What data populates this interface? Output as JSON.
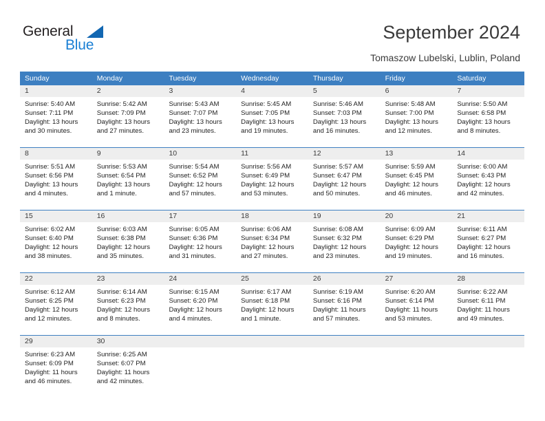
{
  "brand": {
    "name_part1": "General",
    "name_part2": "Blue",
    "logo_shape": "triangle-icon",
    "color_dark": "#231f20",
    "color_blue": "#1a7fd4"
  },
  "header": {
    "title": "September 2024",
    "subtitle": "Tomaszow Lubelski, Lublin, Poland"
  },
  "calendar": {
    "accent_color": "#3d7fc1",
    "daynum_background": "#eeeeee",
    "day_headers": [
      "Sunday",
      "Monday",
      "Tuesday",
      "Wednesday",
      "Thursday",
      "Friday",
      "Saturday"
    ],
    "weeks": [
      {
        "days": [
          {
            "num": "1",
            "sunrise": "Sunrise: 5:40 AM",
            "sunset": "Sunset: 7:11 PM",
            "daylight1": "Daylight: 13 hours",
            "daylight2": "and 30 minutes."
          },
          {
            "num": "2",
            "sunrise": "Sunrise: 5:42 AM",
            "sunset": "Sunset: 7:09 PM",
            "daylight1": "Daylight: 13 hours",
            "daylight2": "and 27 minutes."
          },
          {
            "num": "3",
            "sunrise": "Sunrise: 5:43 AM",
            "sunset": "Sunset: 7:07 PM",
            "daylight1": "Daylight: 13 hours",
            "daylight2": "and 23 minutes."
          },
          {
            "num": "4",
            "sunrise": "Sunrise: 5:45 AM",
            "sunset": "Sunset: 7:05 PM",
            "daylight1": "Daylight: 13 hours",
            "daylight2": "and 19 minutes."
          },
          {
            "num": "5",
            "sunrise": "Sunrise: 5:46 AM",
            "sunset": "Sunset: 7:03 PM",
            "daylight1": "Daylight: 13 hours",
            "daylight2": "and 16 minutes."
          },
          {
            "num": "6",
            "sunrise": "Sunrise: 5:48 AM",
            "sunset": "Sunset: 7:00 PM",
            "daylight1": "Daylight: 13 hours",
            "daylight2": "and 12 minutes."
          },
          {
            "num": "7",
            "sunrise": "Sunrise: 5:50 AM",
            "sunset": "Sunset: 6:58 PM",
            "daylight1": "Daylight: 13 hours",
            "daylight2": "and 8 minutes."
          }
        ]
      },
      {
        "days": [
          {
            "num": "8",
            "sunrise": "Sunrise: 5:51 AM",
            "sunset": "Sunset: 6:56 PM",
            "daylight1": "Daylight: 13 hours",
            "daylight2": "and 4 minutes."
          },
          {
            "num": "9",
            "sunrise": "Sunrise: 5:53 AM",
            "sunset": "Sunset: 6:54 PM",
            "daylight1": "Daylight: 13 hours",
            "daylight2": "and 1 minute."
          },
          {
            "num": "10",
            "sunrise": "Sunrise: 5:54 AM",
            "sunset": "Sunset: 6:52 PM",
            "daylight1": "Daylight: 12 hours",
            "daylight2": "and 57 minutes."
          },
          {
            "num": "11",
            "sunrise": "Sunrise: 5:56 AM",
            "sunset": "Sunset: 6:49 PM",
            "daylight1": "Daylight: 12 hours",
            "daylight2": "and 53 minutes."
          },
          {
            "num": "12",
            "sunrise": "Sunrise: 5:57 AM",
            "sunset": "Sunset: 6:47 PM",
            "daylight1": "Daylight: 12 hours",
            "daylight2": "and 50 minutes."
          },
          {
            "num": "13",
            "sunrise": "Sunrise: 5:59 AM",
            "sunset": "Sunset: 6:45 PM",
            "daylight1": "Daylight: 12 hours",
            "daylight2": "and 46 minutes."
          },
          {
            "num": "14",
            "sunrise": "Sunrise: 6:00 AM",
            "sunset": "Sunset: 6:43 PM",
            "daylight1": "Daylight: 12 hours",
            "daylight2": "and 42 minutes."
          }
        ]
      },
      {
        "days": [
          {
            "num": "15",
            "sunrise": "Sunrise: 6:02 AM",
            "sunset": "Sunset: 6:40 PM",
            "daylight1": "Daylight: 12 hours",
            "daylight2": "and 38 minutes."
          },
          {
            "num": "16",
            "sunrise": "Sunrise: 6:03 AM",
            "sunset": "Sunset: 6:38 PM",
            "daylight1": "Daylight: 12 hours",
            "daylight2": "and 35 minutes."
          },
          {
            "num": "17",
            "sunrise": "Sunrise: 6:05 AM",
            "sunset": "Sunset: 6:36 PM",
            "daylight1": "Daylight: 12 hours",
            "daylight2": "and 31 minutes."
          },
          {
            "num": "18",
            "sunrise": "Sunrise: 6:06 AM",
            "sunset": "Sunset: 6:34 PM",
            "daylight1": "Daylight: 12 hours",
            "daylight2": "and 27 minutes."
          },
          {
            "num": "19",
            "sunrise": "Sunrise: 6:08 AM",
            "sunset": "Sunset: 6:32 PM",
            "daylight1": "Daylight: 12 hours",
            "daylight2": "and 23 minutes."
          },
          {
            "num": "20",
            "sunrise": "Sunrise: 6:09 AM",
            "sunset": "Sunset: 6:29 PM",
            "daylight1": "Daylight: 12 hours",
            "daylight2": "and 19 minutes."
          },
          {
            "num": "21",
            "sunrise": "Sunrise: 6:11 AM",
            "sunset": "Sunset: 6:27 PM",
            "daylight1": "Daylight: 12 hours",
            "daylight2": "and 16 minutes."
          }
        ]
      },
      {
        "days": [
          {
            "num": "22",
            "sunrise": "Sunrise: 6:12 AM",
            "sunset": "Sunset: 6:25 PM",
            "daylight1": "Daylight: 12 hours",
            "daylight2": "and 12 minutes."
          },
          {
            "num": "23",
            "sunrise": "Sunrise: 6:14 AM",
            "sunset": "Sunset: 6:23 PM",
            "daylight1": "Daylight: 12 hours",
            "daylight2": "and 8 minutes."
          },
          {
            "num": "24",
            "sunrise": "Sunrise: 6:15 AM",
            "sunset": "Sunset: 6:20 PM",
            "daylight1": "Daylight: 12 hours",
            "daylight2": "and 4 minutes."
          },
          {
            "num": "25",
            "sunrise": "Sunrise: 6:17 AM",
            "sunset": "Sunset: 6:18 PM",
            "daylight1": "Daylight: 12 hours",
            "daylight2": "and 1 minute."
          },
          {
            "num": "26",
            "sunrise": "Sunrise: 6:19 AM",
            "sunset": "Sunset: 6:16 PM",
            "daylight1": "Daylight: 11 hours",
            "daylight2": "and 57 minutes."
          },
          {
            "num": "27",
            "sunrise": "Sunrise: 6:20 AM",
            "sunset": "Sunset: 6:14 PM",
            "daylight1": "Daylight: 11 hours",
            "daylight2": "and 53 minutes."
          },
          {
            "num": "28",
            "sunrise": "Sunrise: 6:22 AM",
            "sunset": "Sunset: 6:11 PM",
            "daylight1": "Daylight: 11 hours",
            "daylight2": "and 49 minutes."
          }
        ]
      },
      {
        "days": [
          {
            "num": "29",
            "sunrise": "Sunrise: 6:23 AM",
            "sunset": "Sunset: 6:09 PM",
            "daylight1": "Daylight: 11 hours",
            "daylight2": "and 46 minutes."
          },
          {
            "num": "30",
            "sunrise": "Sunrise: 6:25 AM",
            "sunset": "Sunset: 6:07 PM",
            "daylight1": "Daylight: 11 hours",
            "daylight2": "and 42 minutes."
          },
          {
            "num": "",
            "sunrise": "",
            "sunset": "",
            "daylight1": "",
            "daylight2": ""
          },
          {
            "num": "",
            "sunrise": "",
            "sunset": "",
            "daylight1": "",
            "daylight2": ""
          },
          {
            "num": "",
            "sunrise": "",
            "sunset": "",
            "daylight1": "",
            "daylight2": ""
          },
          {
            "num": "",
            "sunrise": "",
            "sunset": "",
            "daylight1": "",
            "daylight2": ""
          },
          {
            "num": "",
            "sunrise": "",
            "sunset": "",
            "daylight1": "",
            "daylight2": ""
          }
        ]
      }
    ]
  }
}
